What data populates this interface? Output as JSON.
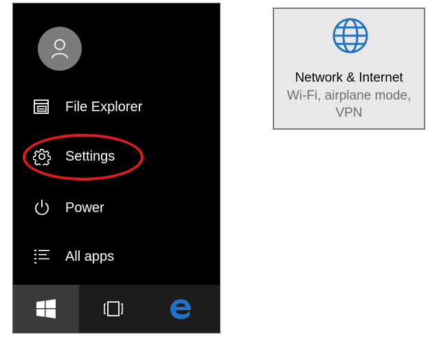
{
  "start_menu": {
    "items": [
      {
        "label": "File Explorer",
        "icon": "file-explorer-icon"
      },
      {
        "label": "Settings",
        "icon": "gear-icon"
      },
      {
        "label": "Power",
        "icon": "power-icon"
      },
      {
        "label": "All apps",
        "icon": "all-apps-icon"
      }
    ],
    "avatar_icon": "user-icon",
    "highlight_color": "#e31b1b"
  },
  "taskbar": {
    "buttons": [
      "windows-start-icon",
      "task-view-icon",
      "edge-browser-icon"
    ],
    "edge_color": "#1e73c8"
  },
  "settings_tile": {
    "title": "Network & Internet",
    "subtitle_line1": "Wi-Fi, airplane mode,",
    "subtitle_line2": "VPN",
    "icon": "globe-icon",
    "icon_color": "#1e73c8"
  }
}
